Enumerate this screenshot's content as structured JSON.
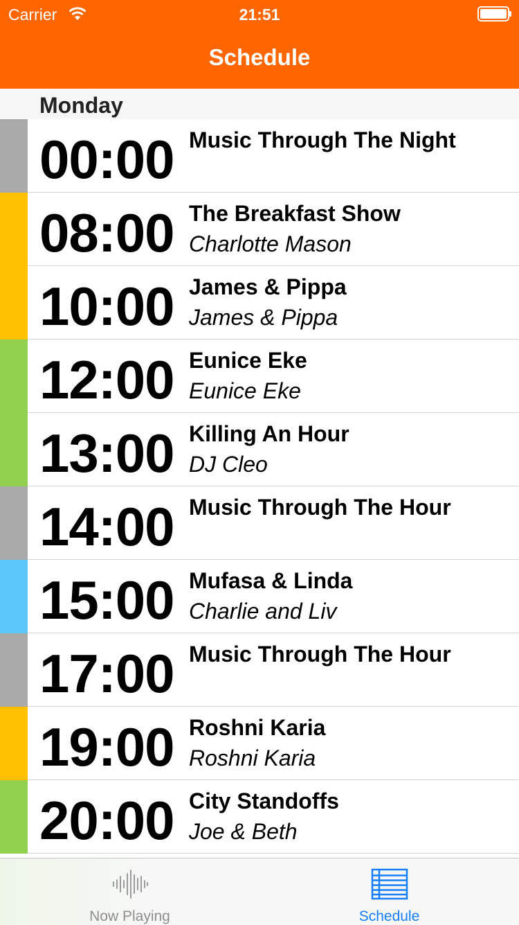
{
  "status_bar": {
    "carrier": "Carrier",
    "time": "21:51",
    "wifi_icon": "wifi-icon",
    "battery_icon": "battery-icon"
  },
  "nav": {
    "title": "Schedule"
  },
  "section": {
    "day": "Monday"
  },
  "colors": {
    "header": "#ff6600",
    "grey": "#aaaaaa",
    "orange": "#ffc000",
    "green": "#92d050",
    "blue": "#5ac8fa",
    "tab_active": "#157efb"
  },
  "schedule": [
    {
      "time": "00:00",
      "title": "Music Through The Night",
      "host": "",
      "color": "#aaaaaa"
    },
    {
      "time": "08:00",
      "title": "The Breakfast Show",
      "host": "Charlotte Mason",
      "color": "#ffc000"
    },
    {
      "time": "10:00",
      "title": "James & Pippa",
      "host": "James & Pippa",
      "color": "#ffc000"
    },
    {
      "time": "12:00",
      "title": "Eunice Eke",
      "host": "Eunice Eke",
      "color": "#92d050"
    },
    {
      "time": "13:00",
      "title": "Killing An Hour",
      "host": "DJ Cleo",
      "color": "#92d050"
    },
    {
      "time": "14:00",
      "title": "Music Through The Hour",
      "host": "",
      "color": "#aaaaaa"
    },
    {
      "time": "15:00",
      "title": "Mufasa & Linda",
      "host": "Charlie and Liv",
      "color": "#5ac8fa"
    },
    {
      "time": "17:00",
      "title": "Music Through The Hour",
      "host": "",
      "color": "#aaaaaa"
    },
    {
      "time": "19:00",
      "title": "Roshni Karia",
      "host": "Roshni Karia",
      "color": "#ffc000"
    },
    {
      "time": "20:00",
      "title": "City Standoffs",
      "host": "Joe & Beth",
      "color": "#92d050"
    }
  ],
  "tabs": [
    {
      "label": "Now Playing",
      "icon": "waveform-icon",
      "active": false
    },
    {
      "label": "Schedule",
      "icon": "list-icon",
      "active": true
    }
  ]
}
